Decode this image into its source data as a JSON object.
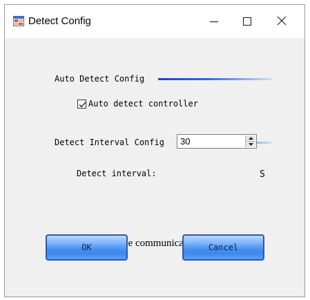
{
  "window": {
    "title": "Detect Config",
    "icon": "app-window-icon",
    "controls": [
      "minimize-icon",
      "maximize-icon",
      "close-icon"
    ]
  },
  "auto_detect": {
    "group_label": "Auto Detect Config",
    "checkbox_label": "Auto detect controller",
    "checked": true
  },
  "interval": {
    "group_label": "Detect Interval Config",
    "field_label": "Detect interval:",
    "value": "30",
    "unit": "S"
  },
  "cascade": {
    "checkbox_label": "Disable cascade communication",
    "checked": false
  },
  "buttons": {
    "ok": "OK",
    "cancel": "Cancel"
  },
  "colors": {
    "accent_line": "#1c3fcf",
    "button_fill": "#4c93f0",
    "button_text": "#0c1f6b"
  }
}
